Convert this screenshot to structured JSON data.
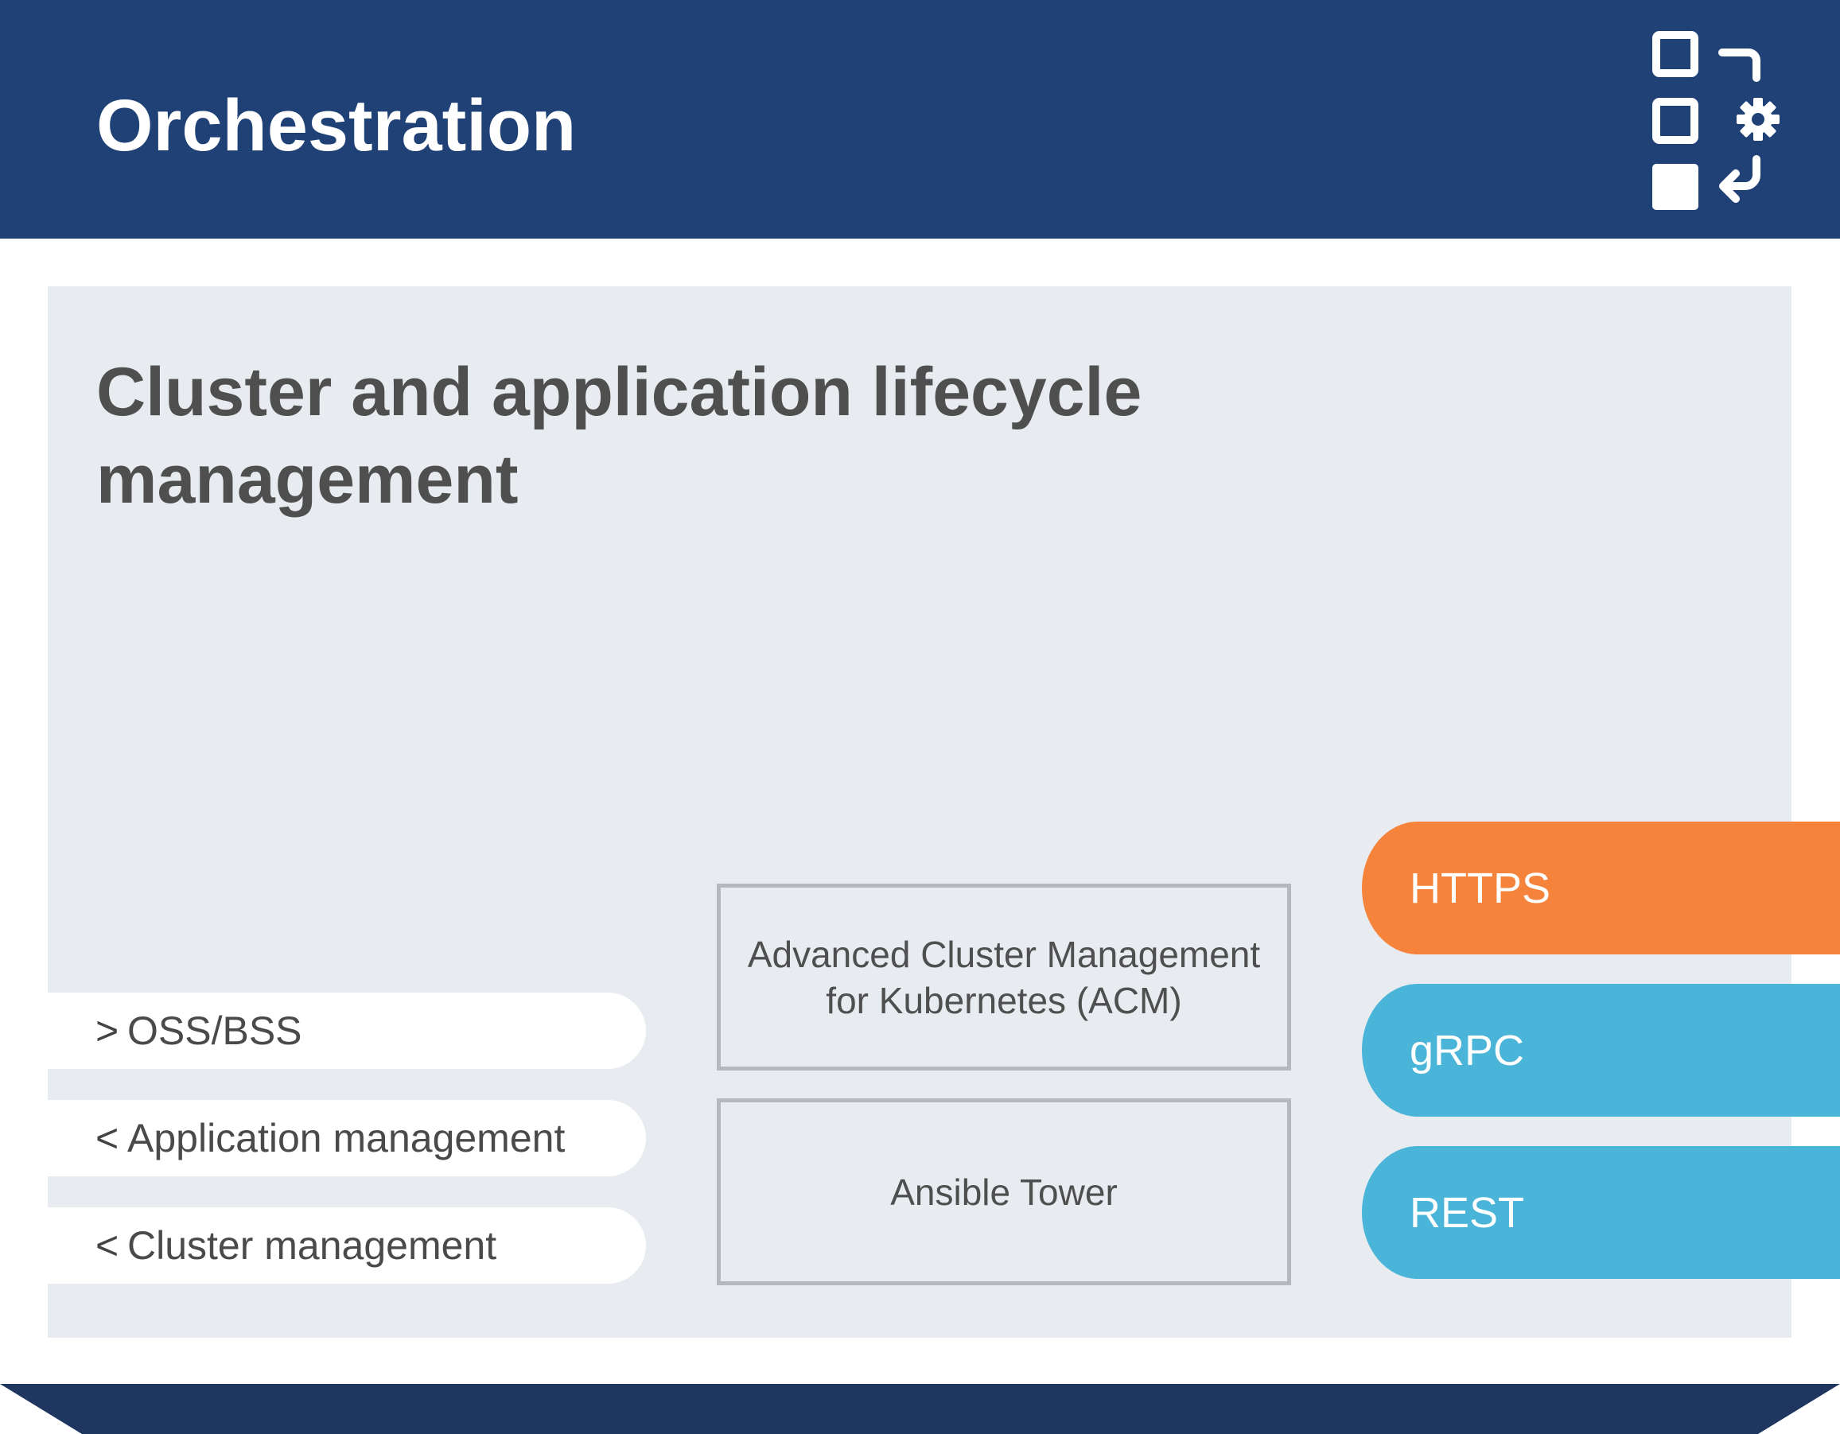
{
  "header": {
    "title": "Orchestration",
    "icon": "orchestration-icon",
    "color": "#1f4175"
  },
  "panel": {
    "title": "Cluster and application lifecycle management",
    "color": "#e8ebf0"
  },
  "interfaces": [
    {
      "arrow": ">",
      "label": "OSS/BSS"
    },
    {
      "arrow": "<",
      "label": "Application management"
    },
    {
      "arrow": "<",
      "label": "Cluster management"
    }
  ],
  "components": {
    "acm": {
      "line1": "Advanced Cluster Management",
      "line2": "for Kubernetes (ACM)"
    },
    "ansible": {
      "label": "Ansible Tower"
    }
  },
  "protocols": [
    {
      "label": "HTTPS",
      "color": "#f5833b"
    },
    {
      "label": "gRPC",
      "color": "#4ab5d8"
    },
    {
      "label": "REST",
      "color": "#4ab5d8"
    }
  ],
  "footer": {
    "color": "#1f3660"
  }
}
